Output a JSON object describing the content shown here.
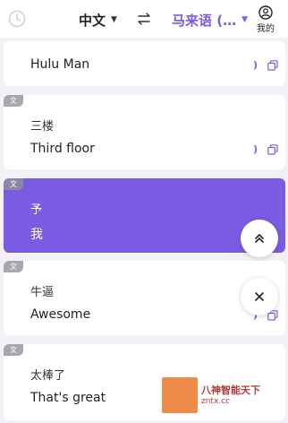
{
  "header": {
    "source_language": "中文",
    "target_language": "马来语 (…",
    "profile_label": "我的"
  },
  "cards": [
    {
      "tag": "",
      "source": "",
      "target": "Hulu Man"
    },
    {
      "tag": "文",
      "source": "三楼",
      "target": "Third floor"
    },
    {
      "tag": "文",
      "source": "予",
      "target": "我"
    },
    {
      "tag": "文",
      "source": "牛逼",
      "target": "Awesome"
    },
    {
      "tag": "文",
      "source": "太棒了",
      "target": "That's great"
    }
  ],
  "watermark": {
    "title": "八神智能天下",
    "url": "zntx.cc"
  },
  "colors": {
    "accent": "#7a5ce3",
    "background": "#f2f1f6",
    "tag": "#a7a7ae"
  }
}
